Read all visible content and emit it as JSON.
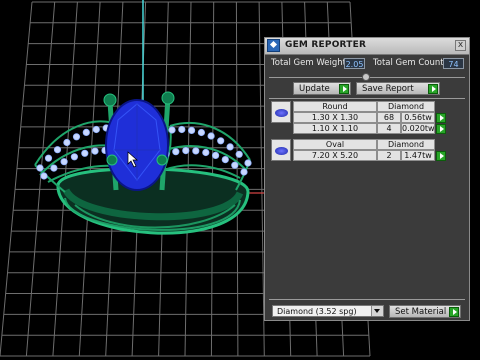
{
  "panel": {
    "title": "GEM REPORTER",
    "close_glyph": "x",
    "total_weight_label": "Total Gem Weight",
    "total_weight_value": "2.05",
    "total_count_label": "Total Gem Count",
    "total_count_value": "74",
    "update_label": "Update",
    "save_report_label": "Save Report",
    "gems": [
      {
        "shape": "Round",
        "material": "Diamond",
        "rows": [
          {
            "size": "1.30 X 1.30",
            "count": "68",
            "weight": "0.56tw"
          },
          {
            "size": "1.10 X 1.10",
            "count": "4",
            "weight": "0.020tw"
          }
        ]
      },
      {
        "shape": "Oval",
        "material": "Diamond",
        "rows": [
          {
            "size": "7.20 X 5.20",
            "count": "2",
            "weight": "1.47tw"
          }
        ]
      }
    ],
    "material_select": "Diamond    (3.52 spg)",
    "set_material_label": "Set Material"
  },
  "colors": {
    "grid": "#7a7a7a",
    "ring": "#1fa56a",
    "center_gem": "#1f2fd8",
    "diamonds": "#c7d7ff",
    "accent_green": "#28a428",
    "value_text": "#8ec3ff"
  }
}
